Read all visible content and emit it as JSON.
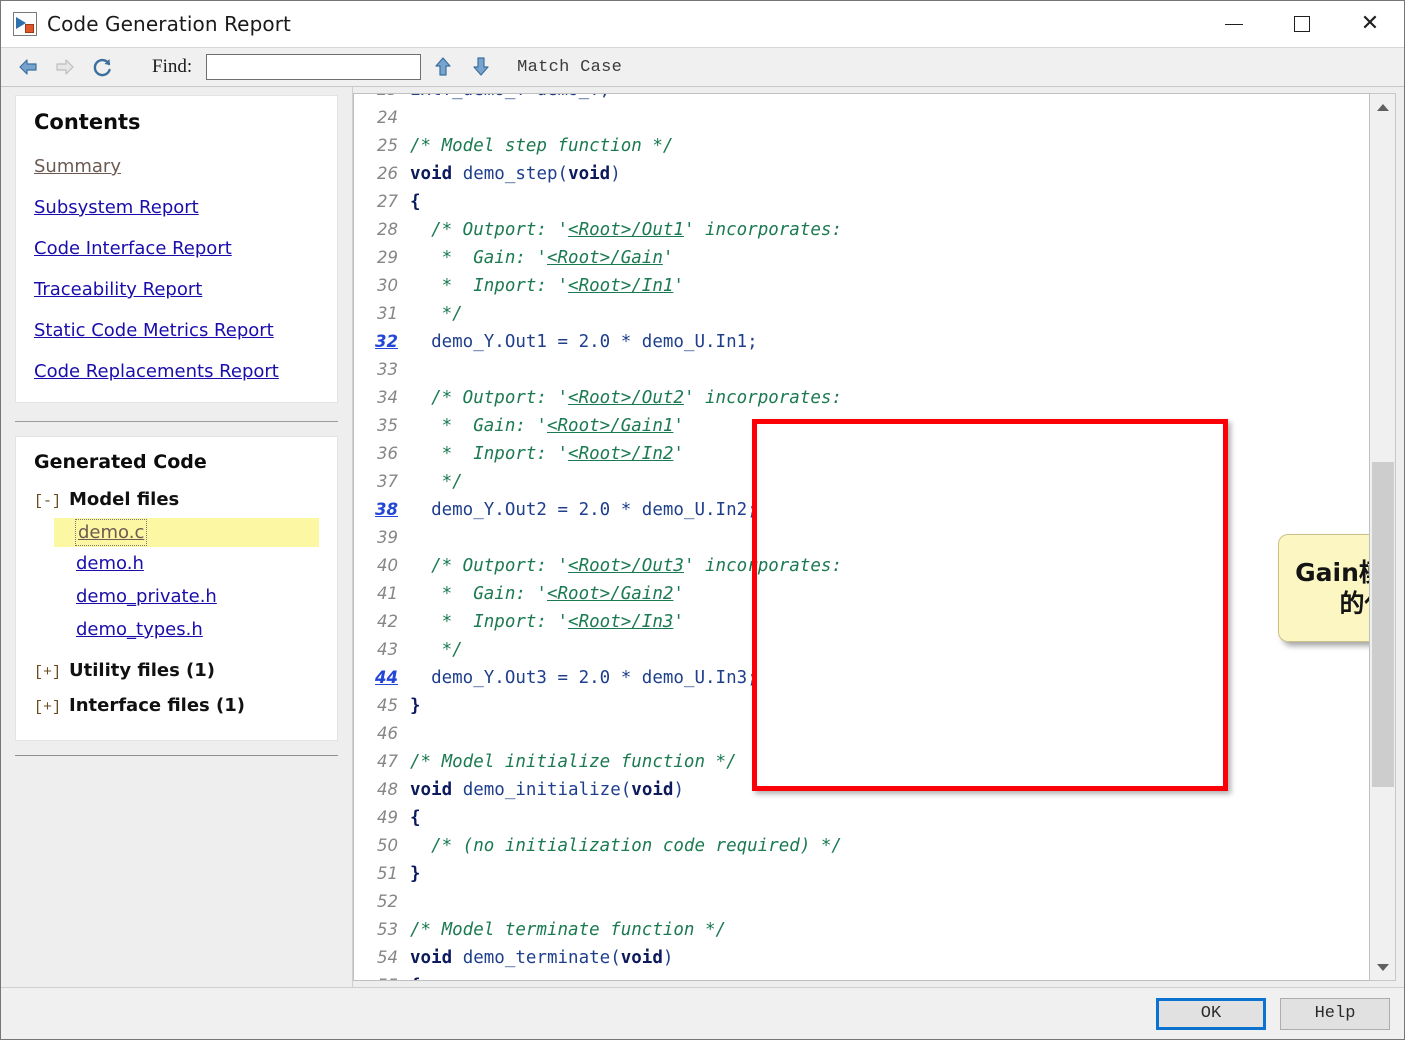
{
  "window": {
    "title": "Code Generation Report",
    "icon": "simulink-report-icon",
    "controls": {
      "minimize": "minimize-icon",
      "maximize": "maximize-icon",
      "close": "close-icon"
    }
  },
  "toolbar": {
    "back": "back-arrow-icon",
    "forward": "forward-arrow-icon",
    "refresh": "refresh-icon",
    "find_label": "Find:",
    "find_value": "",
    "find_placeholder": "",
    "find_prev": "find-up-arrow-icon",
    "find_next": "find-down-arrow-icon",
    "match_case": "Match Case"
  },
  "sidebar": {
    "contents": {
      "title": "Contents",
      "links": [
        {
          "label": "Summary",
          "visited": true
        },
        {
          "label": "Subsystem Report",
          "visited": false
        },
        {
          "label": "Code Interface Report",
          "visited": false
        },
        {
          "label": "Traceability Report",
          "visited": false
        },
        {
          "label": "Static Code Metrics Report",
          "visited": false
        },
        {
          "label": "Code Replacements Report",
          "visited": false
        }
      ]
    },
    "generated_code": {
      "title": "Generated Code",
      "groups": [
        {
          "toggle": "[-]",
          "label": "Model files",
          "files": [
            "demo.c",
            "demo.h",
            "demo_private.h",
            "demo_types.h"
          ],
          "selected": "demo.c"
        },
        {
          "toggle": "[+]",
          "label": "Utility files (1)",
          "files": []
        },
        {
          "toggle": "[+]",
          "label": "Interface files (1)",
          "files": []
        }
      ]
    }
  },
  "code_view": {
    "file": "demo.c",
    "lines": [
      {
        "n": "23",
        "link": false,
        "clipped_top": true,
        "parts": [
          {
            "t": "plain",
            "s": "ExtY_demo_T demo_Y;"
          }
        ]
      },
      {
        "n": "24",
        "link": false,
        "parts": []
      },
      {
        "n": "25",
        "link": false,
        "parts": [
          {
            "t": "cmt",
            "s": "/* Model step function */"
          }
        ]
      },
      {
        "n": "26",
        "link": false,
        "parts": [
          {
            "t": "kw",
            "s": "void"
          },
          {
            "t": "plain",
            "s": " demo_step("
          },
          {
            "t": "kw",
            "s": "void"
          },
          {
            "t": "plain",
            "s": ")"
          }
        ]
      },
      {
        "n": "27",
        "link": false,
        "parts": [
          {
            "t": "kw",
            "s": "{"
          }
        ]
      },
      {
        "n": "28",
        "link": false,
        "parts": [
          {
            "t": "cmt",
            "s": "  /* Outport: '"
          },
          {
            "t": "tlink",
            "s": "<Root>/Out1"
          },
          {
            "t": "cmt",
            "s": "' incorporates:"
          }
        ]
      },
      {
        "n": "29",
        "link": false,
        "parts": [
          {
            "t": "cmt",
            "s": "   *  Gain: '"
          },
          {
            "t": "tlink",
            "s": "<Root>/Gain"
          },
          {
            "t": "cmt",
            "s": "'"
          }
        ]
      },
      {
        "n": "30",
        "link": false,
        "parts": [
          {
            "t": "cmt",
            "s": "   *  Inport: '"
          },
          {
            "t": "tlink",
            "s": "<Root>/In1"
          },
          {
            "t": "cmt",
            "s": "'"
          }
        ]
      },
      {
        "n": "31",
        "link": false,
        "parts": [
          {
            "t": "cmt",
            "s": "   */"
          }
        ]
      },
      {
        "n": "32",
        "link": true,
        "parts": [
          {
            "t": "plain",
            "s": "  demo_Y.Out1 = 2.0 * demo_U.In1;"
          }
        ]
      },
      {
        "n": "33",
        "link": false,
        "parts": []
      },
      {
        "n": "34",
        "link": false,
        "parts": [
          {
            "t": "cmt",
            "s": "  /* Outport: '"
          },
          {
            "t": "tlink",
            "s": "<Root>/Out2"
          },
          {
            "t": "cmt",
            "s": "' incorporates:"
          }
        ]
      },
      {
        "n": "35",
        "link": false,
        "parts": [
          {
            "t": "cmt",
            "s": "   *  Gain: '"
          },
          {
            "t": "tlink",
            "s": "<Root>/Gain1"
          },
          {
            "t": "cmt",
            "s": "'"
          }
        ]
      },
      {
        "n": "36",
        "link": false,
        "parts": [
          {
            "t": "cmt",
            "s": "   *  Inport: '"
          },
          {
            "t": "tlink",
            "s": "<Root>/In2"
          },
          {
            "t": "cmt",
            "s": "'"
          }
        ]
      },
      {
        "n": "37",
        "link": false,
        "parts": [
          {
            "t": "cmt",
            "s": "   */"
          }
        ]
      },
      {
        "n": "38",
        "link": true,
        "parts": [
          {
            "t": "plain",
            "s": "  demo_Y.Out2 = 2.0 * demo_U.In2;"
          }
        ]
      },
      {
        "n": "39",
        "link": false,
        "parts": []
      },
      {
        "n": "40",
        "link": false,
        "parts": [
          {
            "t": "cmt",
            "s": "  /* Outport: '"
          },
          {
            "t": "tlink",
            "s": "<Root>/Out3"
          },
          {
            "t": "cmt",
            "s": "' incorporates:"
          }
        ]
      },
      {
        "n": "41",
        "link": false,
        "parts": [
          {
            "t": "cmt",
            "s": "   *  Gain: '"
          },
          {
            "t": "tlink",
            "s": "<Root>/Gain2"
          },
          {
            "t": "cmt",
            "s": "'"
          }
        ]
      },
      {
        "n": "42",
        "link": false,
        "parts": [
          {
            "t": "cmt",
            "s": "   *  Inport: '"
          },
          {
            "t": "tlink",
            "s": "<Root>/In3"
          },
          {
            "t": "cmt",
            "s": "'"
          }
        ]
      },
      {
        "n": "43",
        "link": false,
        "parts": [
          {
            "t": "cmt",
            "s": "   */"
          }
        ]
      },
      {
        "n": "44",
        "link": true,
        "parts": [
          {
            "t": "plain",
            "s": "  demo_Y.Out3 = 2.0 * demo_U.In3;"
          }
        ]
      },
      {
        "n": "45",
        "link": false,
        "parts": [
          {
            "t": "kw",
            "s": "}"
          }
        ]
      },
      {
        "n": "46",
        "link": false,
        "parts": []
      },
      {
        "n": "47",
        "link": false,
        "parts": [
          {
            "t": "cmt",
            "s": "/* Model initialize function */"
          }
        ]
      },
      {
        "n": "48",
        "link": false,
        "parts": [
          {
            "t": "kw",
            "s": "void"
          },
          {
            "t": "plain",
            "s": " demo_initialize("
          },
          {
            "t": "kw",
            "s": "void"
          },
          {
            "t": "plain",
            "s": ")"
          }
        ]
      },
      {
        "n": "49",
        "link": false,
        "parts": [
          {
            "t": "kw",
            "s": "{"
          }
        ]
      },
      {
        "n": "50",
        "link": false,
        "parts": [
          {
            "t": "cmt",
            "s": "  /* (no initialization code required) */"
          }
        ]
      },
      {
        "n": "51",
        "link": false,
        "parts": [
          {
            "t": "kw",
            "s": "}"
          }
        ]
      },
      {
        "n": "52",
        "link": false,
        "parts": []
      },
      {
        "n": "53",
        "link": false,
        "parts": [
          {
            "t": "cmt",
            "s": "/* Model terminate function */"
          }
        ]
      },
      {
        "n": "54",
        "link": false,
        "parts": [
          {
            "t": "kw",
            "s": "void"
          },
          {
            "t": "plain",
            "s": " demo_terminate("
          },
          {
            "t": "kw",
            "s": "void"
          },
          {
            "t": "plain",
            "s": ")"
          }
        ]
      },
      {
        "n": "55",
        "link": false,
        "clipped_bottom": true,
        "parts": [
          {
            "t": "kw",
            "s": "{"
          }
        ]
      }
    ]
  },
  "annotations": {
    "highlight_box_color": "#fb0007",
    "callout_text": "Gain模块对应的代码",
    "callout_bg": "#fbf6c2"
  },
  "scrollbar": {
    "up": "scroll-up-icon",
    "down": "scroll-down-icon"
  },
  "footer": {
    "ok": "OK",
    "help": "Help"
  }
}
